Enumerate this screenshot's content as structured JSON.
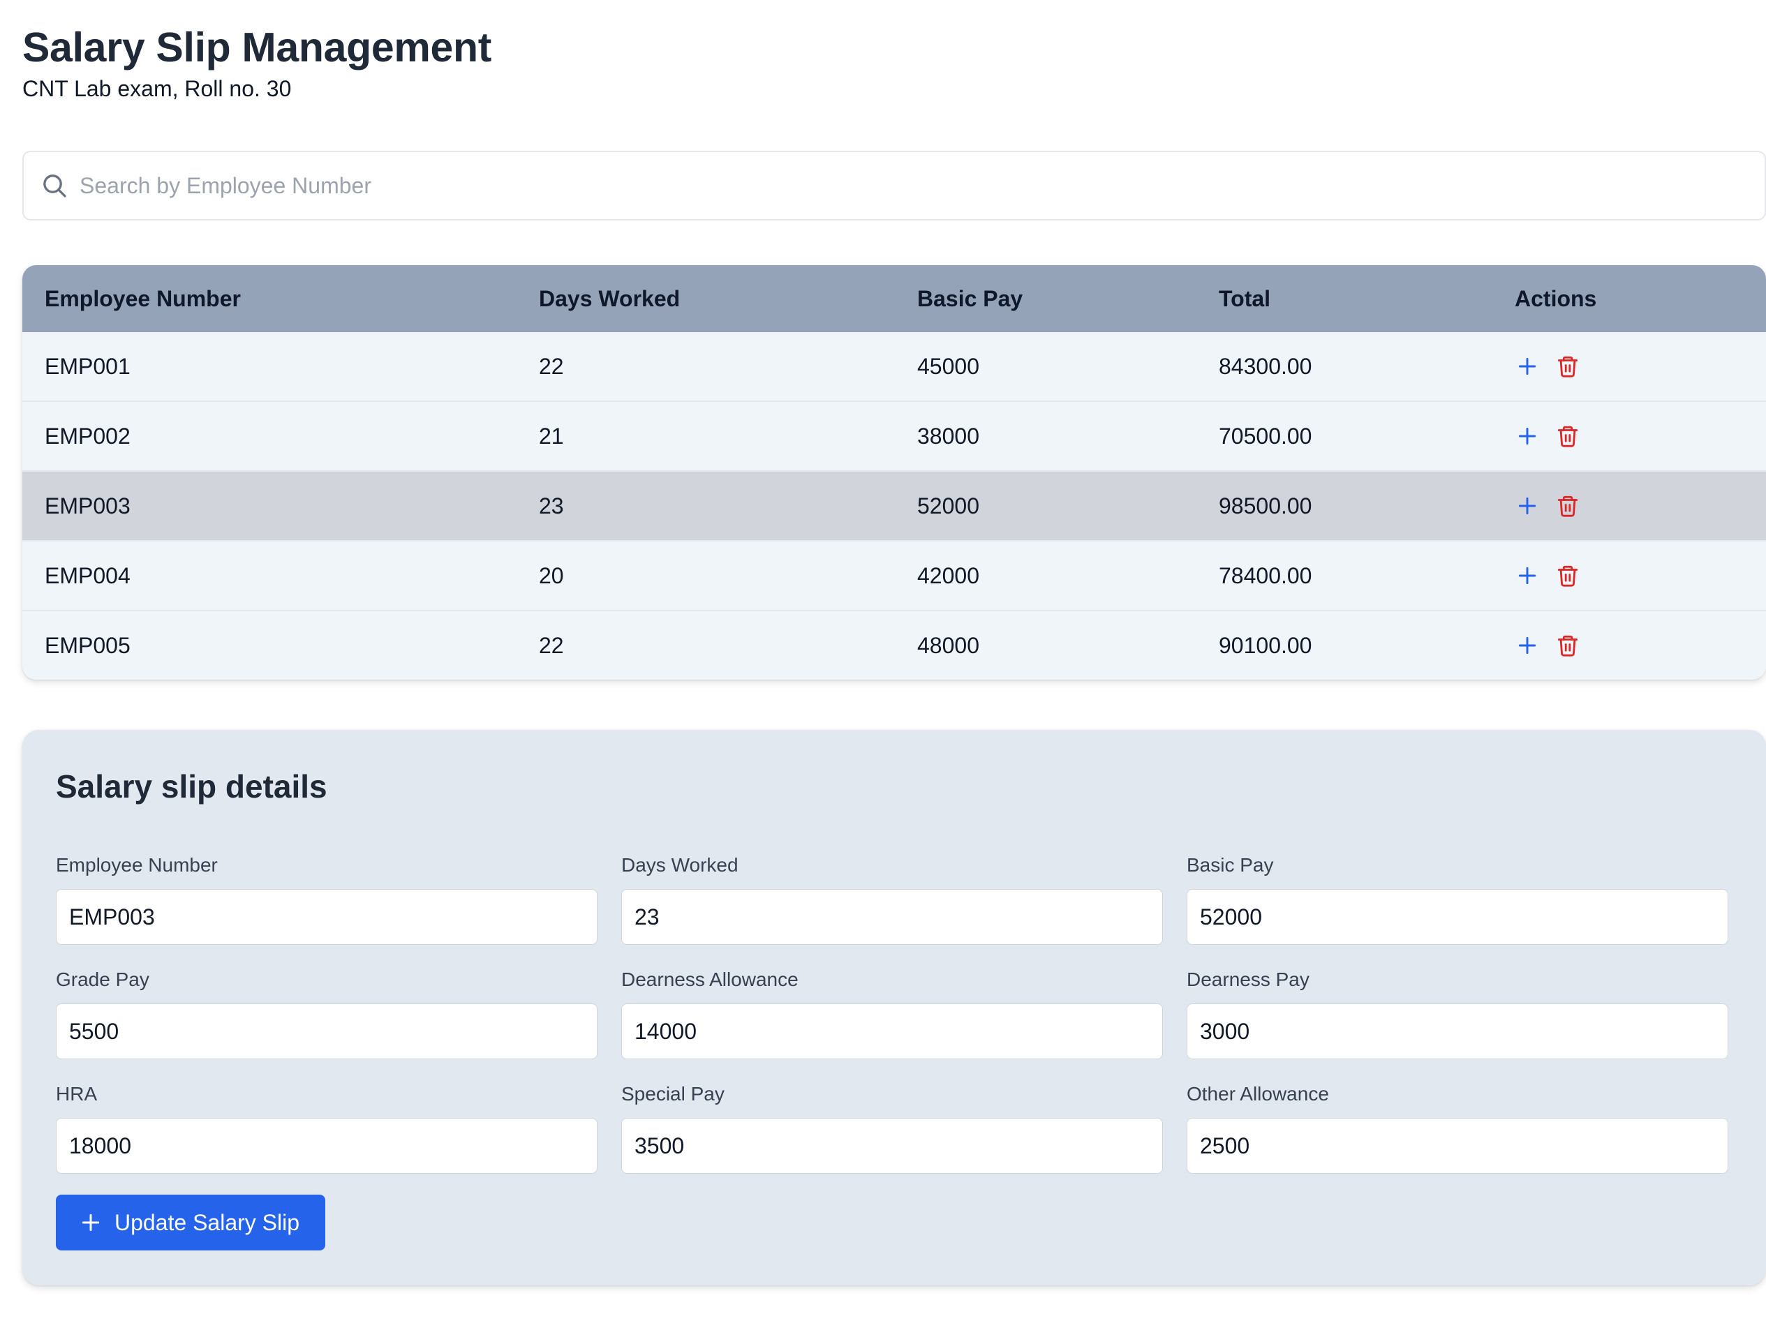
{
  "header": {
    "title": "Salary Slip Management",
    "subtitle": "CNT Lab exam, Roll no. 30"
  },
  "search": {
    "placeholder": "Search by Employee Number",
    "value": "",
    "icon": "search-icon"
  },
  "table": {
    "columns": [
      "Employee Number",
      "Days Worked",
      "Basic Pay",
      "Total",
      "Actions"
    ],
    "rows": [
      {
        "employee_number": "EMP001",
        "days_worked": "22",
        "basic_pay": "45000",
        "total": "84300.00",
        "selected": false
      },
      {
        "employee_number": "EMP002",
        "days_worked": "21",
        "basic_pay": "38000",
        "total": "70500.00",
        "selected": false
      },
      {
        "employee_number": "EMP003",
        "days_worked": "23",
        "basic_pay": "52000",
        "total": "98500.00",
        "selected": true
      },
      {
        "employee_number": "EMP004",
        "days_worked": "20",
        "basic_pay": "42000",
        "total": "78400.00",
        "selected": false
      },
      {
        "employee_number": "EMP005",
        "days_worked": "22",
        "basic_pay": "48000",
        "total": "90100.00",
        "selected": false
      }
    ],
    "action_icons": [
      "plus-icon",
      "trash-icon"
    ]
  },
  "details": {
    "title": "Salary slip details",
    "fields": [
      {
        "label": "Employee Number",
        "value": "EMP003"
      },
      {
        "label": "Days Worked",
        "value": "23"
      },
      {
        "label": "Basic Pay",
        "value": "52000"
      },
      {
        "label": "Grade Pay",
        "value": "5500"
      },
      {
        "label": "Dearness Allowance",
        "value": "14000"
      },
      {
        "label": "Dearness Pay",
        "value": "3000"
      },
      {
        "label": "HRA",
        "value": "18000"
      },
      {
        "label": "Special Pay",
        "value": "3500"
      },
      {
        "label": "Other Allowance",
        "value": "2500"
      }
    ],
    "submit_label": "Update Salary Slip",
    "submit_icon": "plus-icon"
  },
  "colors": {
    "header_bg": "#94a3b8",
    "row_bg": "#f0f5fa",
    "selected_row_bg": "#d1d5db",
    "card_bg": "#e2e8f0",
    "accent": "#2563eb",
    "danger": "#dc2626"
  }
}
